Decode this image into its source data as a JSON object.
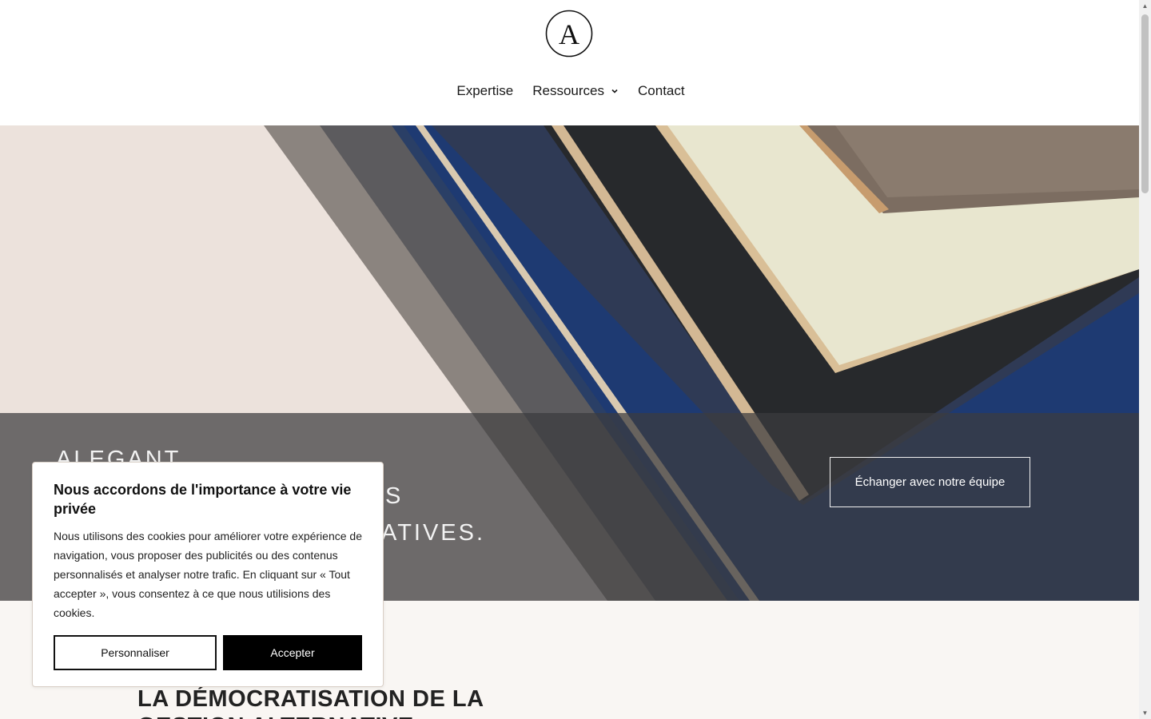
{
  "logo": {
    "letter": "A"
  },
  "nav": {
    "items": [
      {
        "label": "Expertise"
      },
      {
        "label": "Ressources",
        "has_dropdown": true
      },
      {
        "label": "Contact"
      }
    ]
  },
  "hero": {
    "title_line1": "ALEGANT",
    "title_line2": "S",
    "title_line3": "ATIVES.",
    "cta_label": "Échanger avec notre équipe"
  },
  "section": {
    "title": "LA DÉMOCRATISATION DE LA GESTION ALTERNATIVE"
  },
  "cookie": {
    "heading": "Nous accordons de l'importance à votre vie privée",
    "body": "Nous utilisons des cookies pour améliorer votre expérience de navigation, vous proposer des publicités ou des contenus personnalisés et analyser notre trafic. En cliquant sur « Tout accepter », vous consentez à ce que nous utilisions des cookies.",
    "customize_label": "Personnaliser",
    "accept_label": "Accepter"
  },
  "icons": {
    "dropdown": "chevron-down-icon",
    "scroll_up": "scroll-up-arrow",
    "scroll_down": "scroll-down-arrow"
  }
}
